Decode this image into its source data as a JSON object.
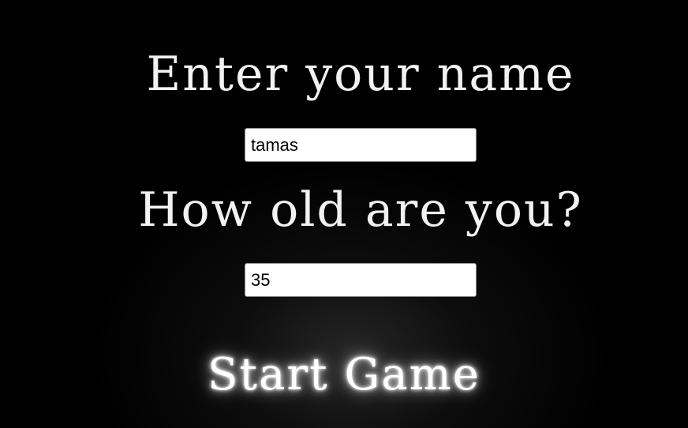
{
  "form": {
    "name_heading": "Enter your name",
    "name_value": "tamas",
    "age_heading": "How old are you?",
    "age_value": "35",
    "start_label": "Start Game"
  },
  "colors": {
    "background": "#000000",
    "heading_text": "#f2f2f2",
    "glow": "#ffffff",
    "input_background": "#ffffff"
  }
}
